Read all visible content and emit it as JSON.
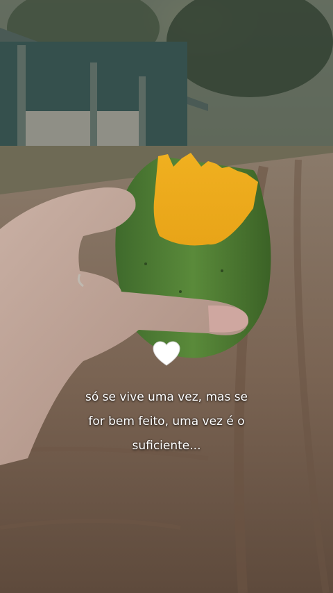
{
  "caption": {
    "lines": [
      "só se vive uma vez, mas se",
      "for bem feito, uma vez é o",
      "suficiente..."
    ]
  },
  "decoration": {
    "heart_icon": "white-heart-emoji"
  }
}
